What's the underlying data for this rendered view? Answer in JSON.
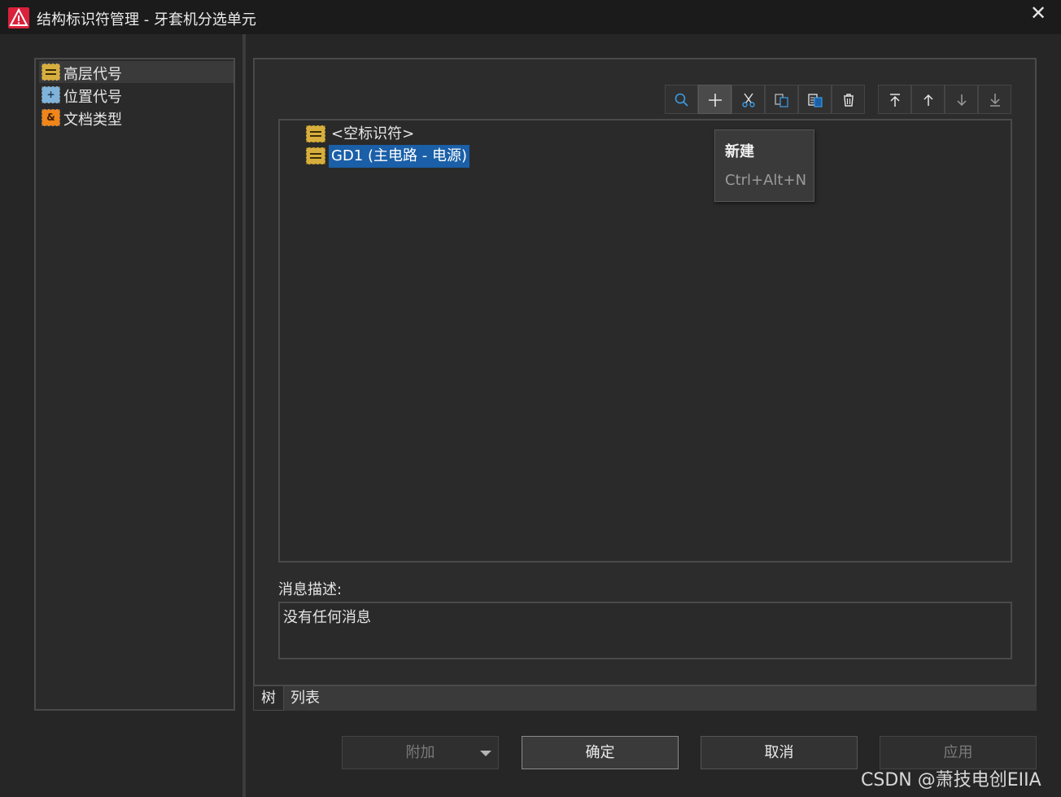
{
  "window": {
    "title": "结构标识符管理 - 牙套机分选单元",
    "close_glyph": "✕"
  },
  "left_panel": {
    "items": [
      {
        "label": "高层代号",
        "icon": "higher-level-icon",
        "icon_glyph": "",
        "selected": true
      },
      {
        "label": "位置代号",
        "icon": "location-icon",
        "icon_glyph": "+",
        "selected": false
      },
      {
        "label": "文档类型",
        "icon": "document-type-icon",
        "icon_glyph": "&",
        "selected": false
      }
    ]
  },
  "toolbar": {
    "buttons": [
      "search-icon",
      "add-icon",
      "cut-icon",
      "copy-icon",
      "paste-icon",
      "delete-icon"
    ],
    "move_buttons": [
      "move-top-icon",
      "move-up-icon",
      "move-down-icon",
      "move-bottom-icon"
    ]
  },
  "tree": {
    "rows": [
      {
        "label": "<空标识符>",
        "selected": false
      },
      {
        "label": "GD1 (主电路 - 电源)",
        "selected": true
      }
    ]
  },
  "tooltip": {
    "title": "新建",
    "shortcut": "Ctrl+Alt+N"
  },
  "message": {
    "label": "消息描述:",
    "text": "没有任何消息"
  },
  "tabs": [
    {
      "label": "树",
      "active": true
    },
    {
      "label": "列表",
      "active": false
    }
  ],
  "buttons": {
    "attach": "附加",
    "ok": "确定",
    "cancel": "取消",
    "apply": "应用"
  },
  "watermark": "CSDN @萧技电创EIIA",
  "colors": {
    "background": "#262626",
    "selection": "#1a5fa8",
    "title_icon": "#d9213b",
    "higher_level_icon": "#d7ae3e",
    "location_icon": "#7fb3d9",
    "document_icon": "#f0851a"
  }
}
